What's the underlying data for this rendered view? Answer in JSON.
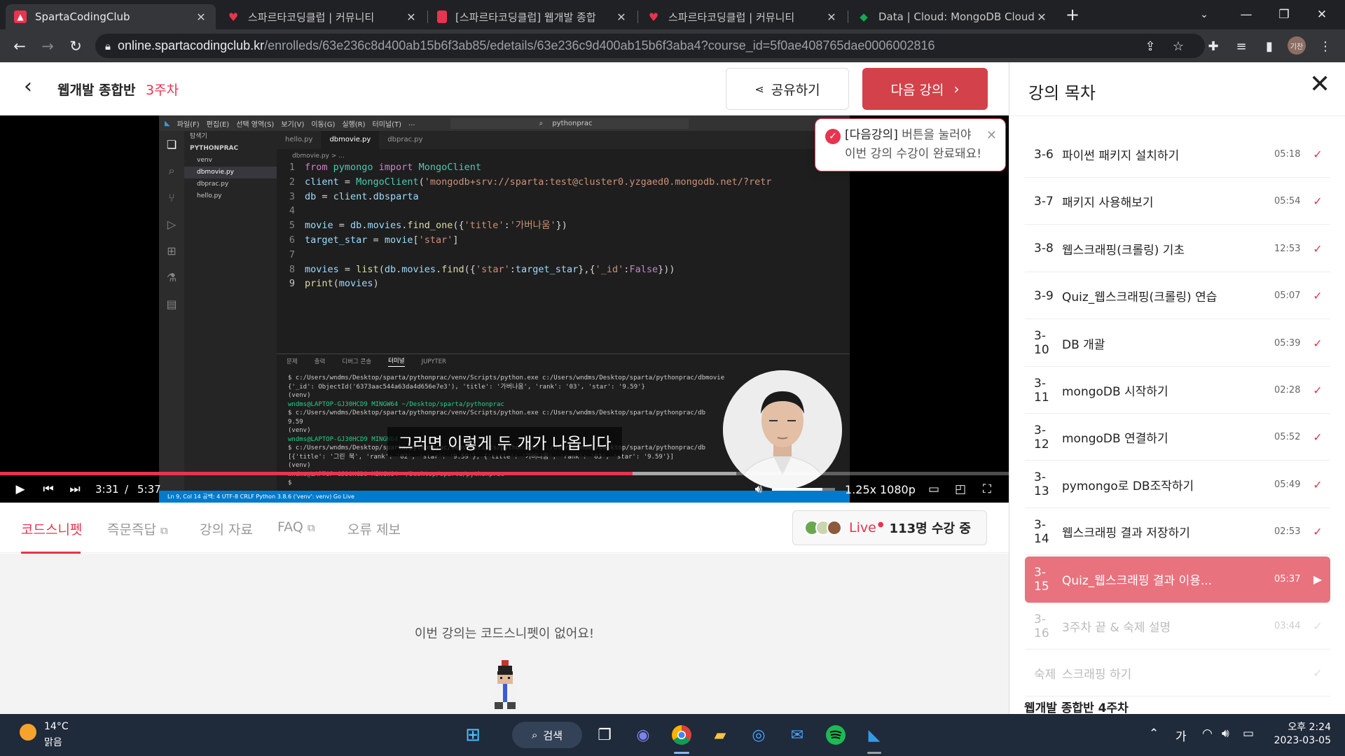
{
  "browser": {
    "tabs": [
      {
        "label": "SpartaCodingClub",
        "active": true
      },
      {
        "label": "스파르타코딩클럽 | 커뮤니티",
        "active": false
      },
      {
        "label": "[스파르타코딩클럽] 웹개발 종합",
        "active": false
      },
      {
        "label": "스파르타코딩클럽 | 커뮤니티",
        "active": false
      },
      {
        "label": "Data | Cloud: MongoDB Cloud",
        "active": false
      }
    ],
    "url_host": "online.spartacodingclub.kr",
    "url_path": "/enrolleds/63e236c8d400ab15b6f3ab85/edetails/63e236c9d400ab15b6f3aba4?course_id=5f0ae408765dae0006002816",
    "profile_label": "기찬"
  },
  "header": {
    "course_title": "웹개발 종합반",
    "week": "3주차",
    "share_label": "공유하기",
    "next_label": "다음 강의"
  },
  "tooltip": {
    "highlight": "[다음강의]",
    "line1_rest": " 버튼을 눌러야",
    "line2": "이번 강의 수강이 완료돼요!"
  },
  "video": {
    "subtitle": "그러면 이렇게 두 개가 나옵니다",
    "current_time": "3:31",
    "separator": "/",
    "duration": "5:37",
    "speed": "1.25x",
    "quality": "1080p",
    "progress_fraction": 0.627,
    "buffered_fraction": 0.73,
    "volume_fraction": 0.8,
    "vscode": {
      "menu": [
        "파일(F)",
        "편집(E)",
        "선택 영역(S)",
        "보기(V)",
        "이동(G)",
        "실행(R)",
        "터미널(T)",
        "..."
      ],
      "search": "pythonprac",
      "explorer_title": "탐색기",
      "project": "PYTHONPRAC",
      "files": [
        "venv",
        "dbmovie.py",
        "dbprac.py",
        "hello.py"
      ],
      "tabs": [
        "hello.py",
        "dbmovie.py",
        "dbprac.py"
      ],
      "breadcrumb": "dbmovie.py > ...",
      "terminal_tabs": [
        "문제",
        "출력",
        "디버그 콘솔",
        "터미널",
        "JUPYTER"
      ],
      "terminal_lines": [
        "$ c:/Users/wndms/Desktop/sparta/pythonprac/venv/Scripts/python.exe c:/Users/wndms/Desktop/sparta/pythonprac/dbmovie",
        "{'_id': ObjectId('6373aac544a63da4d656e7e3'), 'title': '가버나움', 'rank': '03', 'star': '9.59'}",
        "(venv)",
        "wndms@LAPTOP-GJ30HCD9 MINGW64 ~/Desktop/sparta/pythonprac",
        "$ c:/Users/wndms/Desktop/sparta/pythonprac/venv/Scripts/python.exe c:/Users/wndms/Desktop/sparta/pythonprac/db",
        "9.59",
        "(venv)",
        "wndms@LAPTOP-GJ30HCD9 MINGW64",
        "$ c:/Users/wndms/Desktop/sparta/pythonprac/venv/Scripts/python.exe c:/Users/wndms/Desktop/sparta/pythonprac/db",
        "[{'title': '그린 북', 'rank': '02', 'star': '9.59'}, {'title': '가버나움', 'rank': '03', 'star': '9.59'}]",
        "(venv)",
        "wndms@LAPTOP-GJ30HCD9 MINGW64 ~/Desktop/sparta/pythonprac",
        "$"
      ],
      "status": "Ln 9, Col 14   공백: 4   UTF-8   CRLF   Python   3.8.6 ('venv': venv)   Go Live"
    }
  },
  "content_tabs": [
    {
      "label": "코드스니펫",
      "active": true,
      "external": false
    },
    {
      "label": "즉문즉답",
      "active": false,
      "external": true
    },
    {
      "label": "강의 자료",
      "active": false,
      "external": false
    },
    {
      "label": "FAQ",
      "active": false,
      "external": true
    },
    {
      "label": "오류 제보",
      "active": false,
      "external": false
    }
  ],
  "live": {
    "label": "Live",
    "count_text": "113명 수강 중"
  },
  "snippet_empty_message": "이번 강의는 코드스니펫이 없어요!",
  "sidebar": {
    "title": "강의 목차",
    "items": [
      {
        "num": "3-6",
        "title": "파이썬 패키지 설치하기",
        "duration": "05:18",
        "state": "done"
      },
      {
        "num": "3-7",
        "title": "패키지 사용해보기",
        "duration": "05:54",
        "state": "done"
      },
      {
        "num": "3-8",
        "title": "웹스크래핑(크롤링) 기초",
        "duration": "12:53",
        "state": "done"
      },
      {
        "num": "3-9",
        "title": "Quiz_웹스크래핑(크롤링) 연습",
        "duration": "05:07",
        "state": "done"
      },
      {
        "num": "3-10",
        "title": "DB 개괄",
        "duration": "05:39",
        "state": "done"
      },
      {
        "num": "3-11",
        "title": "mongoDB 시작하기",
        "duration": "02:28",
        "state": "done"
      },
      {
        "num": "3-12",
        "title": "mongoDB 연결하기",
        "duration": "05:52",
        "state": "done"
      },
      {
        "num": "3-13",
        "title": "pymongo로 DB조작하기",
        "duration": "05:49",
        "state": "done"
      },
      {
        "num": "3-14",
        "title": "웹스크래핑 결과 저장하기",
        "duration": "02:53",
        "state": "done"
      },
      {
        "num": "3-15",
        "title": "Quiz_웹스크래핑 결과 이용...",
        "duration": "05:37",
        "state": "current"
      },
      {
        "num": "3-16",
        "title": "3주차 끝 & 숙제 설명",
        "duration": "03:44",
        "state": "locked"
      },
      {
        "num": "숙제",
        "title": "스크래핑 하기",
        "duration": "",
        "state": "locked"
      }
    ],
    "next_section": "웹개발 종합반 4주차"
  },
  "taskbar": {
    "temp": "14°C",
    "weather": "맑음",
    "search_label": "검색",
    "ime": "가",
    "time": "오후 2:24",
    "date": "2023-03-05"
  },
  "colors": {
    "accent": "#e8344e",
    "next_button": "#d3424a",
    "current_item": "#e8727d"
  }
}
